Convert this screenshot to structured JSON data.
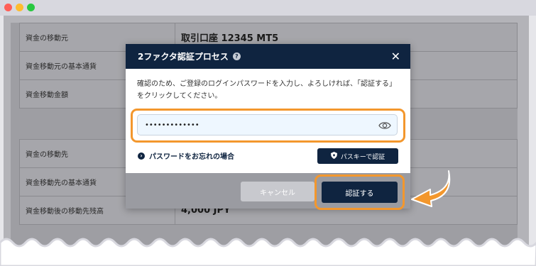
{
  "window": {
    "traffic_lights": [
      "close",
      "minimize",
      "maximize"
    ]
  },
  "background": {
    "card1": [
      {
        "label": "資金の移動元",
        "value": "取引口座 12345 MT5"
      },
      {
        "label": "資金移動元の基本通貨",
        "value": ""
      },
      {
        "label": "資金移動金額",
        "value": ""
      }
    ],
    "card2": [
      {
        "label": "資金の移動先",
        "value": ""
      },
      {
        "label": "資金移動先の基本通貨",
        "value": ""
      },
      {
        "label": "資金移動後の移動先残高",
        "value": "4,000 JPY"
      }
    ]
  },
  "modal": {
    "title": "2ファクタ認証プロセス",
    "help_icon": "?",
    "close_icon": "✕",
    "instruction": "確認のため、ご登録のログインパスワードを入力し、よろしければ、「認証する」をクリックしてください。",
    "password_value": "•••••••••••••",
    "forgot_label": "パスワードをお忘れの場合",
    "passkey_label": "パスキーで認証",
    "cancel_label": "キャンセル",
    "confirm_label": "認証する"
  },
  "colors": {
    "accent": "#f3972d",
    "navy": "#0f2440"
  }
}
